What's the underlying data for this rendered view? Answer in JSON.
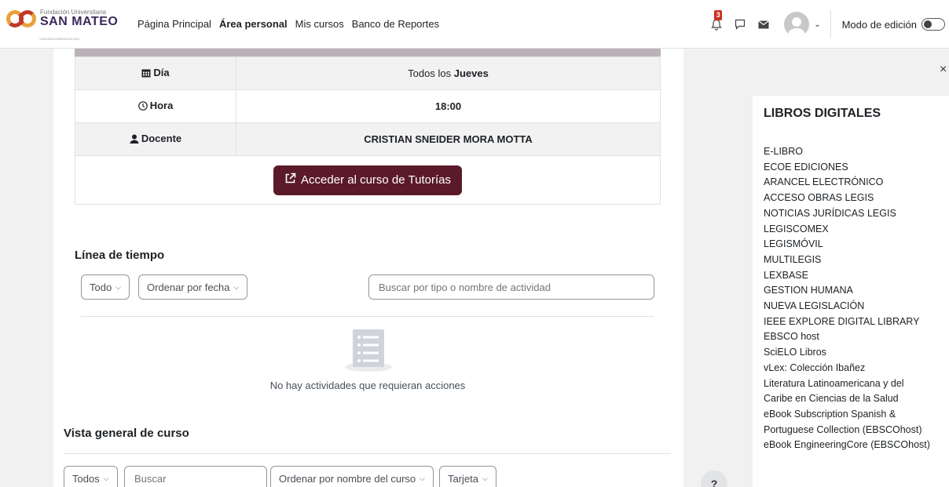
{
  "header": {
    "logo_small": "Fundación Universitaria",
    "logo_big": "SAN MATEO",
    "logo_tag": "VIGILADA MINEDUCACIÓN",
    "nav": [
      {
        "label": "Página Principal",
        "active": false
      },
      {
        "label": "Área personal",
        "active": true
      },
      {
        "label": "Mis cursos",
        "active": false
      },
      {
        "label": "Banco de Reportes",
        "active": false
      }
    ],
    "notification_count": "3",
    "edit_mode_label": "Modo de edición"
  },
  "schedule": {
    "day_label": "Día",
    "day_prefix": "Todos los ",
    "day_value": "Jueves",
    "hour_label": "Hora",
    "hour_value": "18:00",
    "teacher_label": "Docente",
    "teacher_value": "CRISTIAN SNEIDER MORA MOTTA",
    "button_label": "Acceder al curso de Tutorías"
  },
  "timeline": {
    "title": "Línea de tiempo",
    "filter": "Todo",
    "sort": "Ordenar por fecha",
    "search_placeholder": "Buscar por tipo o nombre de actividad",
    "empty_text": "No hay actividades que requieran acciones"
  },
  "course_overview": {
    "title": "Vista general de curso",
    "filter": "Todos",
    "search_placeholder": "Buscar",
    "sort": "Ordenar por nombre del curso",
    "view": "Tarjeta"
  },
  "help_label": "?",
  "drawer": {
    "close_label": "×",
    "title": "LIBROS DIGITALES",
    "items": [
      "E-LIBRO",
      "ECOE EDICIONES",
      "ARANCEL ELECTRÓNICO",
      "ACCESO OBRAS LEGIS",
      "NOTICIAS JURÍDICAS LEGIS",
      "LEGISCOMEX",
      "LEGISMÓVIL",
      "MULTILEGIS",
      "LEXBASE",
      "GESTION HUMANA",
      "NUEVA LEGISLACIÓN",
      "IEEE EXPLORE DIGITAL LIBRARY",
      "EBSCO host",
      "SciELO Libros",
      "vLex: Colección Ibañez",
      "Literatura Latinoamericana y del",
      "Caribe en Ciencias de la Salud",
      "eBook Subscription Spanish &",
      "Portuguese Collection (EBSCOhost)",
      "eBook EngineeringCore (EBSCOhost)"
    ]
  },
  "colors": {
    "accent": "#5a1a2a",
    "badge": "#ca3120"
  }
}
